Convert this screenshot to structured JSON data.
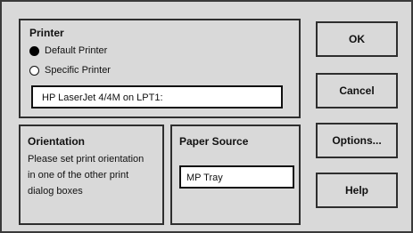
{
  "printer": {
    "title": "Printer",
    "options": [
      {
        "label": "Default Printer",
        "selected": true
      },
      {
        "label": "Specific Printer",
        "selected": false
      }
    ],
    "selected_printer": "HP LaserJet 4/4M on LPT1:"
  },
  "orientation": {
    "title": "Orientation",
    "message": "Please set print orientation in one of the other print dialog boxes"
  },
  "paper_source": {
    "title": "Paper Source",
    "value": "MP Tray"
  },
  "buttons": {
    "ok": "OK",
    "cancel": "Cancel",
    "options": "Options...",
    "help": "Help"
  }
}
